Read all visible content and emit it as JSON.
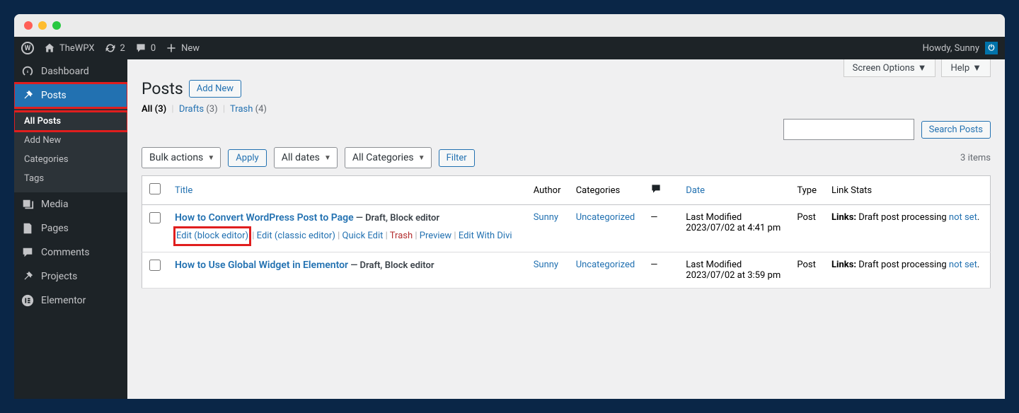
{
  "adminBar": {
    "siteName": "TheWPX",
    "updateCount": "2",
    "commentCount": "0",
    "newLabel": "New",
    "howdy": "Howdy, Sunny"
  },
  "sidebar": {
    "items": [
      {
        "label": "Dashboard",
        "icon": "dashboard"
      },
      {
        "label": "Posts",
        "icon": "posts",
        "active": true
      },
      {
        "label": "Media",
        "icon": "media"
      },
      {
        "label": "Pages",
        "icon": "pages"
      },
      {
        "label": "Comments",
        "icon": "comments"
      },
      {
        "label": "Projects",
        "icon": "projects"
      },
      {
        "label": "Elementor",
        "icon": "elementor"
      }
    ],
    "postsSubmenu": [
      {
        "label": "All Posts",
        "current": true
      },
      {
        "label": "Add New"
      },
      {
        "label": "Categories"
      },
      {
        "label": "Tags"
      }
    ]
  },
  "topOptions": {
    "screenOptions": "Screen Options",
    "help": "Help"
  },
  "header": {
    "title": "Posts",
    "addNew": "Add New"
  },
  "filters": {
    "all": "All",
    "allCount": "(3)",
    "drafts": "Drafts",
    "draftsCount": "(3)",
    "trash": "Trash",
    "trashCount": "(4)"
  },
  "search": {
    "button": "Search Posts"
  },
  "bulk": {
    "bulkActions": "Bulk actions",
    "apply": "Apply",
    "allDates": "All dates",
    "allCategories": "All Categories",
    "filter": "Filter",
    "itemCount": "3 items"
  },
  "columns": {
    "title": "Title",
    "author": "Author",
    "categories": "Categories",
    "date": "Date",
    "type": "Type",
    "linkStats": "Link Stats"
  },
  "rows": [
    {
      "title": "How to Convert WordPress Post to Page",
      "state": "— Draft, Block editor",
      "actions": {
        "editBlock": "Edit (block editor)",
        "editClassic": "Edit (classic editor)",
        "quickEdit": "Quick Edit",
        "trash": "Trash",
        "preview": "Preview",
        "editDivi": "Edit With Divi"
      },
      "author": "Sunny",
      "categories": "Uncategorized",
      "comments": "—",
      "dateLabel": "Last Modified",
      "dateValue": "2023/07/02 at 4:41 pm",
      "type": "Post",
      "linksLabel": "Links:",
      "linksText": "Draft post processing",
      "linksNotSet": "not set"
    },
    {
      "title": "How to Use Global Widget in Elementor",
      "state": "— Draft, Block editor",
      "author": "Sunny",
      "categories": "Uncategorized",
      "comments": "—",
      "dateLabel": "Last Modified",
      "dateValue": "2023/07/02 at 3:59 pm",
      "type": "Post",
      "linksLabel": "Links:",
      "linksText": "Draft post processing",
      "linksNotSet": "not set"
    }
  ]
}
